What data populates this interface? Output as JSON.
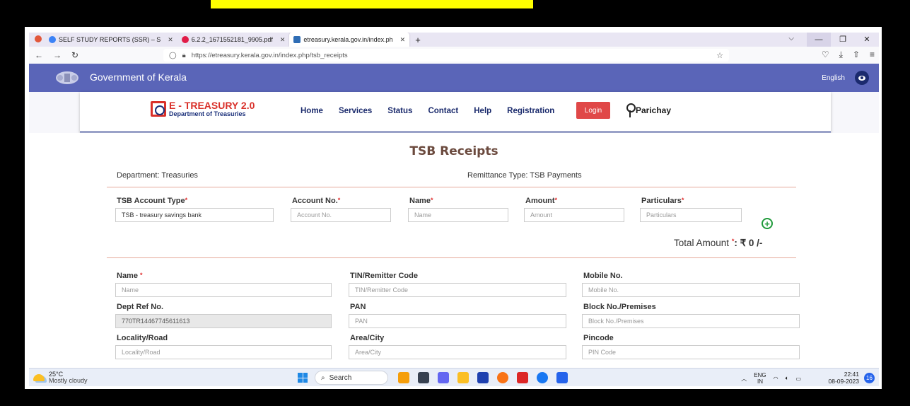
{
  "browser": {
    "tabs": [
      {
        "label": "SELF STUDY REPORTS (SSR) – S",
        "active": false
      },
      {
        "label": "6.2.2_1671552181_9905.pdf",
        "active": false
      },
      {
        "label": "etreasury.kerala.gov.in/index.ph",
        "active": true
      }
    ],
    "new_tab": "+",
    "url": "https://etreasury.kerala.gov.in/index.php/tsb_receipts"
  },
  "header": {
    "title": "Government of Kerala",
    "language": "English"
  },
  "nav": {
    "logo_title": "E - TREASURY 2.0",
    "logo_subtitle": "Department of Treasuries",
    "items": [
      "Home",
      "Services",
      "Status",
      "Contact",
      "Help",
      "Registration"
    ],
    "login": "Login",
    "parichay": "Parichay"
  },
  "page": {
    "title": "TSB Receipts",
    "department": "Department: Treasuries",
    "remittance_type": "Remittance Type: TSB Payments",
    "row1": {
      "tsb_account_type": {
        "label": "TSB Account Type",
        "value": "TSB - treasury savings bank"
      },
      "account_no": {
        "label": "Account No.",
        "placeholder": "Account No."
      },
      "name": {
        "label": "Name",
        "placeholder": "Name"
      },
      "amount": {
        "label": "Amount",
        "placeholder": "Amount"
      },
      "particulars": {
        "label": "Particulars",
        "placeholder": "Particulars"
      }
    },
    "total": {
      "label": "Total Amount",
      "value": ": ₹ 0 /-"
    },
    "remitter": {
      "name": {
        "label": "Name",
        "placeholder": "Name"
      },
      "tin": {
        "label": "TIN/Remitter Code",
        "placeholder": "TIN/Remitter Code"
      },
      "mobile": {
        "label": "Mobile No.",
        "placeholder": "Mobile No."
      },
      "dept_ref": {
        "label": "Dept Ref No.",
        "value": "770TR14467745611613"
      },
      "pan": {
        "label": "PAN",
        "placeholder": "PAN"
      },
      "block": {
        "label": "Block No./Premises",
        "placeholder": "Block No./Premises"
      },
      "locality": {
        "label": "Locality/Road",
        "placeholder": "Locality/Road"
      },
      "area": {
        "label": "Area/City",
        "placeholder": "Area/City"
      },
      "pincode": {
        "label": "Pincode",
        "placeholder": "PIN Code"
      }
    }
  },
  "taskbar": {
    "temp": "25°C",
    "weather": "Mostly cloudy",
    "search": "Search",
    "lang1": "ENG",
    "lang2": "IN",
    "time": "22:41",
    "date": "08-09-2023",
    "notifications": "16"
  },
  "colors": {
    "accent": "#5a65b8",
    "login": "#e04848",
    "title": "#6b4a3e"
  }
}
